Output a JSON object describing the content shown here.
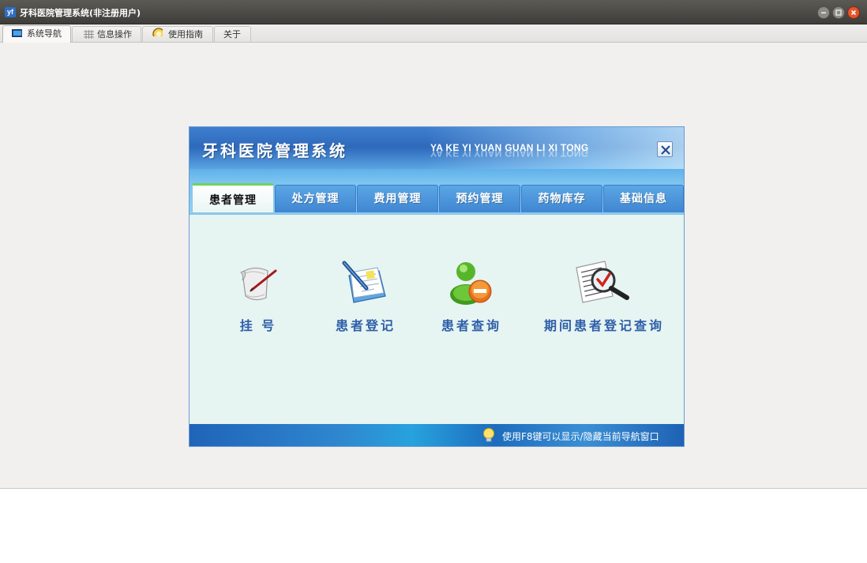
{
  "window": {
    "title": "牙科医院管理系统(非注册用户)"
  },
  "top_tabs": [
    {
      "label": "系统导航",
      "icon": "monitor-icon",
      "active": true
    },
    {
      "label": "信息操作",
      "icon": "grid-icon",
      "active": false
    },
    {
      "label": "使用指南",
      "icon": "help-circle-icon",
      "active": false
    },
    {
      "label": "关于",
      "icon": "",
      "active": false
    }
  ],
  "navigator": {
    "title": "牙科医院管理系统",
    "pinyin": "YA KE YI YUAN GUAN LI XI TONG",
    "tabs": [
      {
        "label": "患者管理",
        "active": true
      },
      {
        "label": "处方管理",
        "active": false
      },
      {
        "label": "费用管理",
        "active": false
      },
      {
        "label": "预约管理",
        "active": false
      },
      {
        "label": "药物库存",
        "active": false
      },
      {
        "label": "基础信息",
        "active": false
      }
    ],
    "items": [
      {
        "label": "挂  号",
        "icon": "scroll-pen-icon"
      },
      {
        "label": "患者登记",
        "icon": "document-pen-icon"
      },
      {
        "label": "患者查询",
        "icon": "user-search-icon"
      },
      {
        "label": "期间患者登记查询",
        "icon": "document-magnifier-icon"
      }
    ],
    "footer_hint": "使用F8键可以显示/隐藏当前导航窗口"
  },
  "colors": {
    "header_blue": "#2e69bb",
    "tab_active_accent": "#6fd35c",
    "body_bg": "#e6f4f2",
    "item_label": "#2e5ea8"
  }
}
